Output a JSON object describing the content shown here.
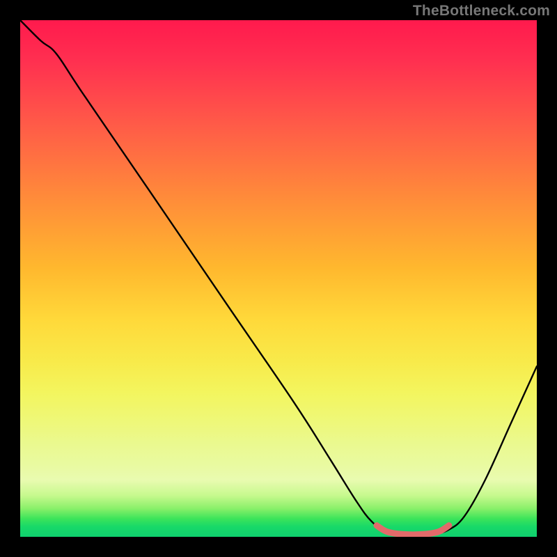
{
  "watermark": "TheBottleneck.com",
  "chart_data": {
    "type": "line",
    "title": "",
    "xlabel": "",
    "ylabel": "",
    "xlim": [
      0,
      100
    ],
    "ylim": [
      0,
      100
    ],
    "series": [
      {
        "name": "curve",
        "color": "#000000",
        "points": [
          {
            "x": 0,
            "y": 100
          },
          {
            "x": 4,
            "y": 96
          },
          {
            "x": 7,
            "y": 93.5
          },
          {
            "x": 12,
            "y": 86
          },
          {
            "x": 25,
            "y": 67
          },
          {
            "x": 40,
            "y": 45
          },
          {
            "x": 53,
            "y": 26
          },
          {
            "x": 60,
            "y": 15
          },
          {
            "x": 65,
            "y": 7
          },
          {
            "x": 68,
            "y": 3
          },
          {
            "x": 71,
            "y": 1
          },
          {
            "x": 75,
            "y": 0.4
          },
          {
            "x": 80,
            "y": 0.6
          },
          {
            "x": 83,
            "y": 1.4
          },
          {
            "x": 86,
            "y": 4
          },
          {
            "x": 90,
            "y": 11
          },
          {
            "x": 95,
            "y": 22
          },
          {
            "x": 100,
            "y": 33
          }
        ]
      },
      {
        "name": "highlight",
        "color": "#e26a6a",
        "points": [
          {
            "x": 69,
            "y": 2.2
          },
          {
            "x": 71,
            "y": 1.0
          },
          {
            "x": 74,
            "y": 0.5
          },
          {
            "x": 78,
            "y": 0.5
          },
          {
            "x": 81,
            "y": 1.0
          },
          {
            "x": 83,
            "y": 2.2
          }
        ]
      }
    ],
    "annotations": []
  }
}
